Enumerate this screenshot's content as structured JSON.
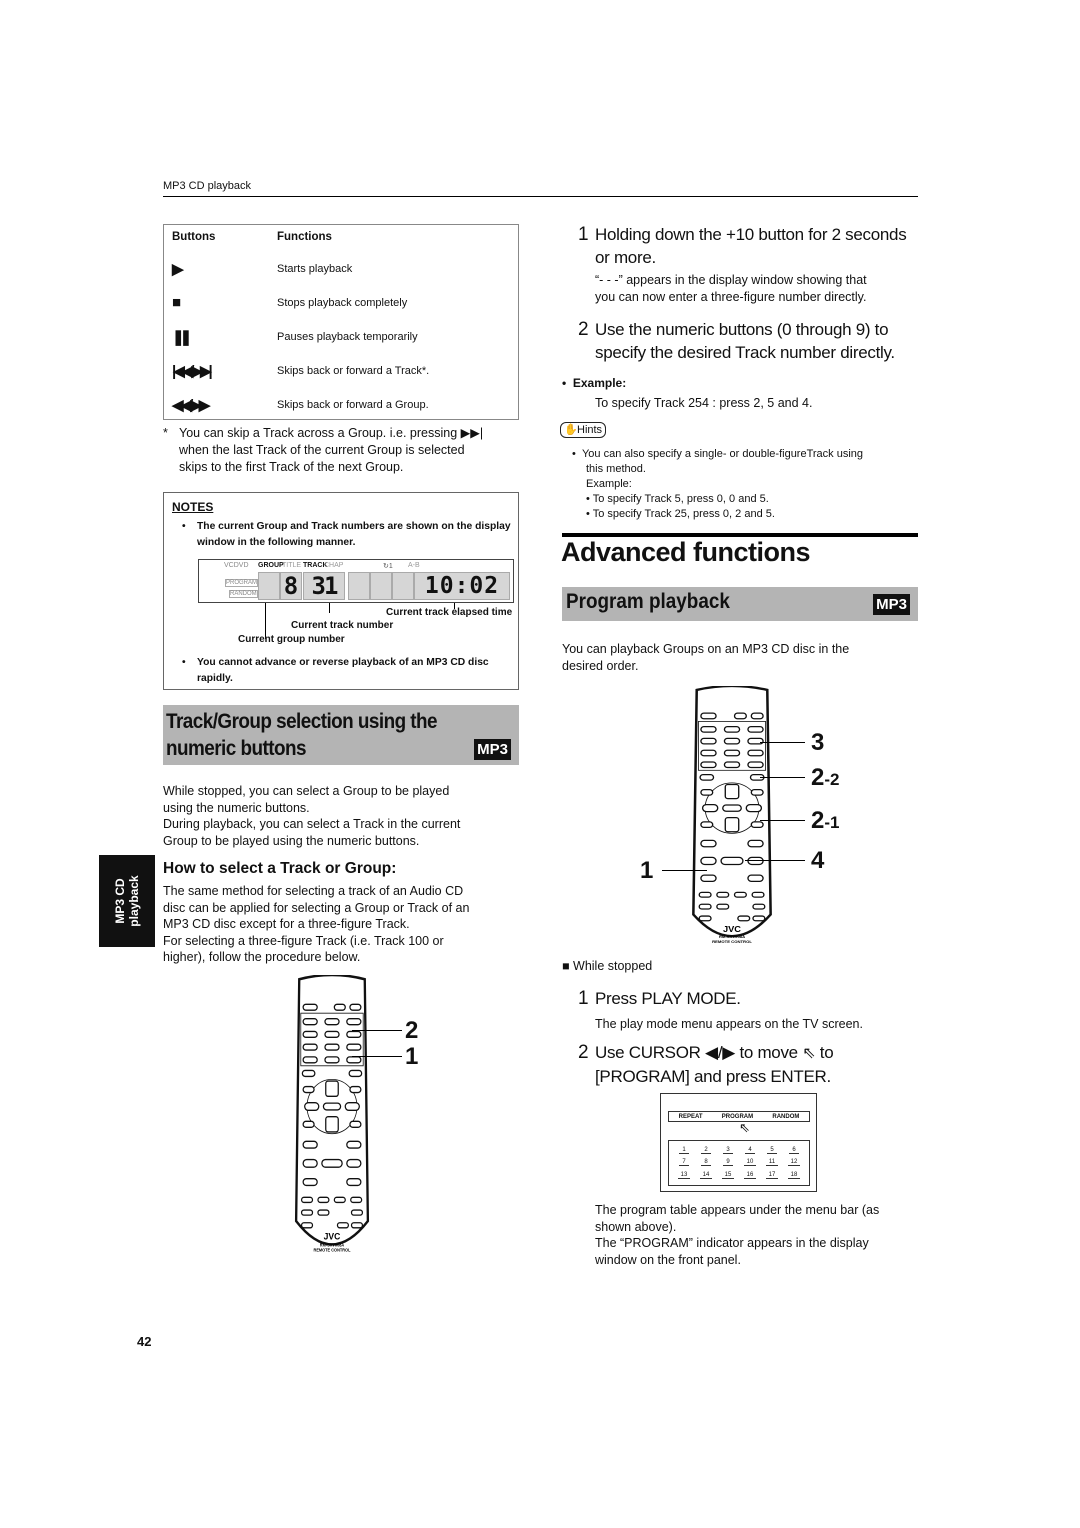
{
  "header": {
    "section": "MP3 CD playback"
  },
  "side_tab": {
    "line1": "MP3 CD",
    "line2": "playback"
  },
  "page_number": "42",
  "button_table": {
    "headers": [
      "Buttons",
      "Functions"
    ],
    "rows": [
      {
        "button": "play-icon",
        "symbol": "▶",
        "function": "Starts playback"
      },
      {
        "button": "stop-icon",
        "symbol": "■",
        "function": "Stops playback completely"
      },
      {
        "button": "pause-icon",
        "symbol": "❚❚",
        "function": "Pauses playback temporarily"
      },
      {
        "button": "skip-track-icon",
        "symbol": "|◀◀/▶▶|",
        "function": "Skips back or forward a Track*."
      },
      {
        "button": "skip-group-icon",
        "symbol": "◀◀/▶▶",
        "function": "Skips back or forward a Group."
      }
    ],
    "footnote": [
      "*",
      "You can skip a Track across a Group. i.e. pressing ▶▶|",
      "when the last Track of the current Group is selected",
      "skips to the first Track of the next Group."
    ]
  },
  "notes": {
    "title": "NOTES",
    "items": [
      "The current Group and Track numbers are shown on the display window in the following manner.",
      "You cannot advance or reverse playback of an MP3 CD disc rapidly."
    ],
    "display": {
      "vcd": "VCDVD",
      "group": "GROUP",
      "title": "TITLE",
      "track": "TRACK",
      "chap": "CHAP",
      "repeat": "↻1",
      "ab": "A-B",
      "program": "PROGRAM",
      "random": "RANDOM",
      "group_digit": "8",
      "track_digits": "31",
      "time": "10:02"
    },
    "callouts": {
      "elapsed": "Current track elapsed time",
      "track": "Current track number",
      "group": "Current group number"
    }
  },
  "track_group": {
    "title_line1": "Track/Group selection using the",
    "title_line2": "numeric buttons",
    "badge": "MP3",
    "intro": [
      "While stopped, you can select a Group to be played",
      "using the numeric buttons.",
      "During playback, you can select a Track in the current",
      "Group to be played using the numeric buttons."
    ],
    "howto_title": "How to select a Track or Group:",
    "howto": [
      "The same method for selecting a track of an Audio CD",
      "disc can be applied for selecting a Group or Track of an",
      "MP3 CD disc except for a three-figure Track.",
      "For selecting a three-figure Track (i.e. Track 100 or",
      "higher), follow the procedure below."
    ],
    "remote_labels": [
      "2",
      "1"
    ]
  },
  "steps_top": [
    {
      "num": "1",
      "text": "Holding down the +10 button for 2 seconds or more.",
      "note": [
        "“- - -” appears in the display window showing that",
        "you can now enter a three-figure number directly."
      ]
    },
    {
      "num": "2",
      "text": "Use the numeric buttons (0 through 9) to specify the desired Track number directly."
    }
  ],
  "example": {
    "label": "Example:",
    "text": "To specify Track 254 : press 2, 5 and 4."
  },
  "hints": {
    "label": "Hints",
    "lines": [
      "You can also specify a single- or double-figureTrack using",
      "this method.",
      "Example:",
      "• To specify Track 5, press 0, 0 and 5.",
      "• To specify Track 25, press 0, 2 and 5."
    ]
  },
  "advanced": {
    "title": "Advanced functions"
  },
  "program": {
    "title": "Program playback",
    "badge": "MP3",
    "intro": [
      "You can playback Groups on an MP3 CD disc in the",
      "desired order."
    ],
    "remote_labels": [
      "3",
      "2",
      "-2",
      "2",
      "-1",
      "4",
      "1"
    ],
    "condition": "While stopped",
    "step1": {
      "num": "1",
      "text": "Press PLAY MODE.",
      "note": "The play mode menu appears on the TV screen."
    },
    "step2": {
      "num": "2",
      "line1a": "Use CURSOR ◀/▶ to move",
      "line1b": "to",
      "line2": "[PROGRAM] and press ENTER."
    },
    "menu": {
      "items": [
        "REPEAT",
        "PROGRAM",
        "RANDOM"
      ],
      "numbers": [
        "1",
        "2",
        "3",
        "4",
        "5",
        "6",
        "7",
        "8",
        "9",
        "10",
        "11",
        "12",
        "13",
        "14",
        "15",
        "16",
        "17",
        "18"
      ]
    },
    "after": [
      "The program table appears under the menu bar (as",
      "shown above).",
      "The “PROGRAM” indicator appears in the display",
      "window on the front panel."
    ]
  },
  "remote": {
    "brand": "JVC",
    "model": "RM-SXV008A",
    "caption": "REMOTE CONTROL"
  }
}
